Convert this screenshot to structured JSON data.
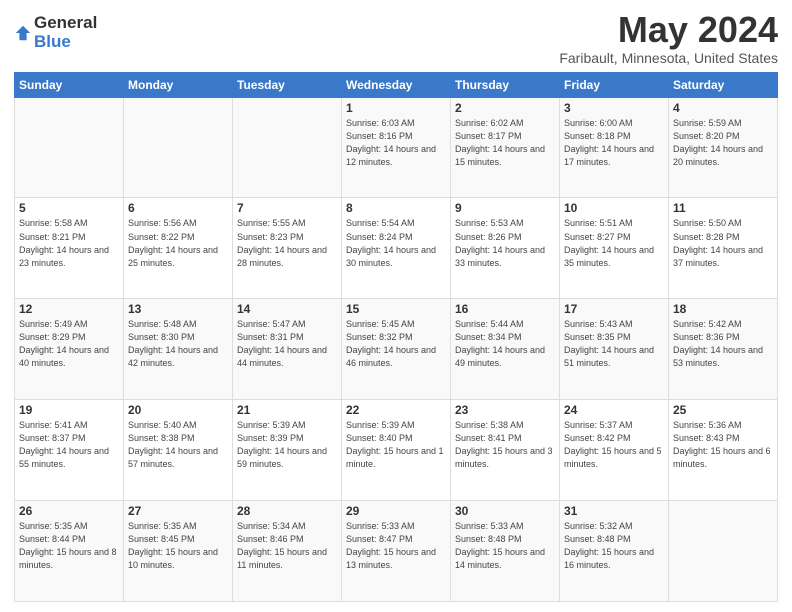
{
  "logo": {
    "general": "General",
    "blue": "Blue"
  },
  "header": {
    "title": "May 2024",
    "subtitle": "Faribault, Minnesota, United States"
  },
  "weekdays": [
    "Sunday",
    "Monday",
    "Tuesday",
    "Wednesday",
    "Thursday",
    "Friday",
    "Saturday"
  ],
  "weeks": [
    [
      {
        "day": "",
        "sunrise": "",
        "sunset": "",
        "daylight": ""
      },
      {
        "day": "",
        "sunrise": "",
        "sunset": "",
        "daylight": ""
      },
      {
        "day": "",
        "sunrise": "",
        "sunset": "",
        "daylight": ""
      },
      {
        "day": "1",
        "sunrise": "Sunrise: 6:03 AM",
        "sunset": "Sunset: 8:16 PM",
        "daylight": "Daylight: 14 hours and 12 minutes."
      },
      {
        "day": "2",
        "sunrise": "Sunrise: 6:02 AM",
        "sunset": "Sunset: 8:17 PM",
        "daylight": "Daylight: 14 hours and 15 minutes."
      },
      {
        "day": "3",
        "sunrise": "Sunrise: 6:00 AM",
        "sunset": "Sunset: 8:18 PM",
        "daylight": "Daylight: 14 hours and 17 minutes."
      },
      {
        "day": "4",
        "sunrise": "Sunrise: 5:59 AM",
        "sunset": "Sunset: 8:20 PM",
        "daylight": "Daylight: 14 hours and 20 minutes."
      }
    ],
    [
      {
        "day": "5",
        "sunrise": "Sunrise: 5:58 AM",
        "sunset": "Sunset: 8:21 PM",
        "daylight": "Daylight: 14 hours and 23 minutes."
      },
      {
        "day": "6",
        "sunrise": "Sunrise: 5:56 AM",
        "sunset": "Sunset: 8:22 PM",
        "daylight": "Daylight: 14 hours and 25 minutes."
      },
      {
        "day": "7",
        "sunrise": "Sunrise: 5:55 AM",
        "sunset": "Sunset: 8:23 PM",
        "daylight": "Daylight: 14 hours and 28 minutes."
      },
      {
        "day": "8",
        "sunrise": "Sunrise: 5:54 AM",
        "sunset": "Sunset: 8:24 PM",
        "daylight": "Daylight: 14 hours and 30 minutes."
      },
      {
        "day": "9",
        "sunrise": "Sunrise: 5:53 AM",
        "sunset": "Sunset: 8:26 PM",
        "daylight": "Daylight: 14 hours and 33 minutes."
      },
      {
        "day": "10",
        "sunrise": "Sunrise: 5:51 AM",
        "sunset": "Sunset: 8:27 PM",
        "daylight": "Daylight: 14 hours and 35 minutes."
      },
      {
        "day": "11",
        "sunrise": "Sunrise: 5:50 AM",
        "sunset": "Sunset: 8:28 PM",
        "daylight": "Daylight: 14 hours and 37 minutes."
      }
    ],
    [
      {
        "day": "12",
        "sunrise": "Sunrise: 5:49 AM",
        "sunset": "Sunset: 8:29 PM",
        "daylight": "Daylight: 14 hours and 40 minutes."
      },
      {
        "day": "13",
        "sunrise": "Sunrise: 5:48 AM",
        "sunset": "Sunset: 8:30 PM",
        "daylight": "Daylight: 14 hours and 42 minutes."
      },
      {
        "day": "14",
        "sunrise": "Sunrise: 5:47 AM",
        "sunset": "Sunset: 8:31 PM",
        "daylight": "Daylight: 14 hours and 44 minutes."
      },
      {
        "day": "15",
        "sunrise": "Sunrise: 5:45 AM",
        "sunset": "Sunset: 8:32 PM",
        "daylight": "Daylight: 14 hours and 46 minutes."
      },
      {
        "day": "16",
        "sunrise": "Sunrise: 5:44 AM",
        "sunset": "Sunset: 8:34 PM",
        "daylight": "Daylight: 14 hours and 49 minutes."
      },
      {
        "day": "17",
        "sunrise": "Sunrise: 5:43 AM",
        "sunset": "Sunset: 8:35 PM",
        "daylight": "Daylight: 14 hours and 51 minutes."
      },
      {
        "day": "18",
        "sunrise": "Sunrise: 5:42 AM",
        "sunset": "Sunset: 8:36 PM",
        "daylight": "Daylight: 14 hours and 53 minutes."
      }
    ],
    [
      {
        "day": "19",
        "sunrise": "Sunrise: 5:41 AM",
        "sunset": "Sunset: 8:37 PM",
        "daylight": "Daylight: 14 hours and 55 minutes."
      },
      {
        "day": "20",
        "sunrise": "Sunrise: 5:40 AM",
        "sunset": "Sunset: 8:38 PM",
        "daylight": "Daylight: 14 hours and 57 minutes."
      },
      {
        "day": "21",
        "sunrise": "Sunrise: 5:39 AM",
        "sunset": "Sunset: 8:39 PM",
        "daylight": "Daylight: 14 hours and 59 minutes."
      },
      {
        "day": "22",
        "sunrise": "Sunrise: 5:39 AM",
        "sunset": "Sunset: 8:40 PM",
        "daylight": "Daylight: 15 hours and 1 minute."
      },
      {
        "day": "23",
        "sunrise": "Sunrise: 5:38 AM",
        "sunset": "Sunset: 8:41 PM",
        "daylight": "Daylight: 15 hours and 3 minutes."
      },
      {
        "day": "24",
        "sunrise": "Sunrise: 5:37 AM",
        "sunset": "Sunset: 8:42 PM",
        "daylight": "Daylight: 15 hours and 5 minutes."
      },
      {
        "day": "25",
        "sunrise": "Sunrise: 5:36 AM",
        "sunset": "Sunset: 8:43 PM",
        "daylight": "Daylight: 15 hours and 6 minutes."
      }
    ],
    [
      {
        "day": "26",
        "sunrise": "Sunrise: 5:35 AM",
        "sunset": "Sunset: 8:44 PM",
        "daylight": "Daylight: 15 hours and 8 minutes."
      },
      {
        "day": "27",
        "sunrise": "Sunrise: 5:35 AM",
        "sunset": "Sunset: 8:45 PM",
        "daylight": "Daylight: 15 hours and 10 minutes."
      },
      {
        "day": "28",
        "sunrise": "Sunrise: 5:34 AM",
        "sunset": "Sunset: 8:46 PM",
        "daylight": "Daylight: 15 hours and 11 minutes."
      },
      {
        "day": "29",
        "sunrise": "Sunrise: 5:33 AM",
        "sunset": "Sunset: 8:47 PM",
        "daylight": "Daylight: 15 hours and 13 minutes."
      },
      {
        "day": "30",
        "sunrise": "Sunrise: 5:33 AM",
        "sunset": "Sunset: 8:48 PM",
        "daylight": "Daylight: 15 hours and 14 minutes."
      },
      {
        "day": "31",
        "sunrise": "Sunrise: 5:32 AM",
        "sunset": "Sunset: 8:48 PM",
        "daylight": "Daylight: 15 hours and 16 minutes."
      },
      {
        "day": "",
        "sunrise": "",
        "sunset": "",
        "daylight": ""
      }
    ]
  ]
}
